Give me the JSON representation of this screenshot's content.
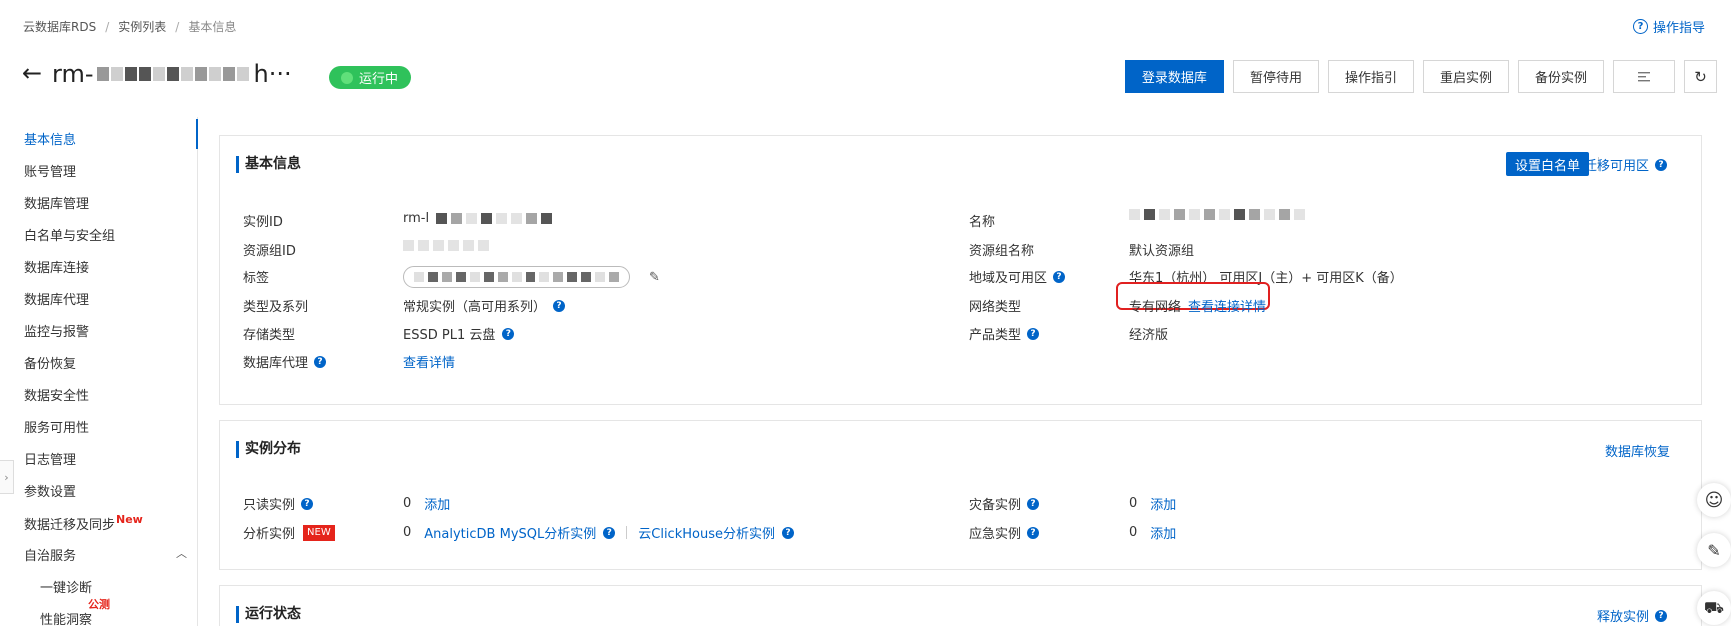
{
  "breadcrumb": [
    "云数据库RDS",
    "实例列表",
    "基本信息"
  ],
  "help_link": "操作指导",
  "instance": {
    "title_prefix": "rm-",
    "title_suffix": "h···",
    "status": "运行中"
  },
  "actions": {
    "login": "登录数据库",
    "pause": "暂停待用",
    "guide": "操作指引",
    "restart": "重启实例",
    "backup": "备份实例"
  },
  "sidebar": {
    "items": [
      {
        "label": "基本信息",
        "active": true
      },
      {
        "label": "账号管理"
      },
      {
        "label": "数据库管理"
      },
      {
        "label": "白名单与安全组"
      },
      {
        "label": "数据库连接"
      },
      {
        "label": "数据库代理"
      },
      {
        "label": "监控与报警"
      },
      {
        "label": "备份恢复"
      },
      {
        "label": "数据安全性"
      },
      {
        "label": "服务可用性"
      },
      {
        "label": "日志管理"
      },
      {
        "label": "参数设置"
      },
      {
        "label": "数据迁移及同步",
        "badge": "New"
      },
      {
        "label": "自治服务"
      },
      {
        "label": "一键诊断"
      },
      {
        "label": "性能洞察",
        "badge": "公测"
      }
    ]
  },
  "basic_info": {
    "title": "基本信息",
    "whitelist_btn": "设置白名单",
    "migrate_link": "迁移可用区",
    "instance_id_label": "实例ID",
    "instance_id_prefix": "rm-l",
    "resource_group_id_label": "资源组ID",
    "tag_label": "标签",
    "type_label": "类型及系列",
    "type_value": "常规实例（高可用系列）",
    "storage_label": "存储类型",
    "storage_value": "ESSD PL1 云盘",
    "proxy_label": "数据库代理",
    "proxy_value": "查看详情",
    "name_label": "名称",
    "resource_group_name_label": "资源组名称",
    "resource_group_name_value": "默认资源组",
    "region_label": "地域及可用区",
    "region_value": "华东1（杭州） 可用区J（主）+ 可用区K（备）",
    "network_label": "网络类型",
    "network_value": "专有网络",
    "network_link": "查看连接详情",
    "product_label": "产品类型",
    "product_value": "经济版"
  },
  "distribution": {
    "title": "实例分布",
    "restore_link": "数据库恢复",
    "readonly_label": "只读实例",
    "readonly_count": "0",
    "readonly_add": "添加",
    "analytic_label": "分析实例",
    "analytic_badge": "NEW",
    "analytic_count": "0",
    "analytic_link1": "AnalyticDB MySQL分析实例",
    "analytic_link2": "云ClickHouse分析实例",
    "dr_label": "灾备实例",
    "dr_count": "0",
    "dr_add": "添加",
    "emergency_label": "应急实例",
    "emergency_count": "0",
    "emergency_add": "添加"
  },
  "runtime": {
    "title": "运行状态",
    "release_link": "释放实例"
  },
  "colors": {
    "primary": "#0064c8",
    "running": "#2fc25b",
    "highlight": "#e02020"
  }
}
